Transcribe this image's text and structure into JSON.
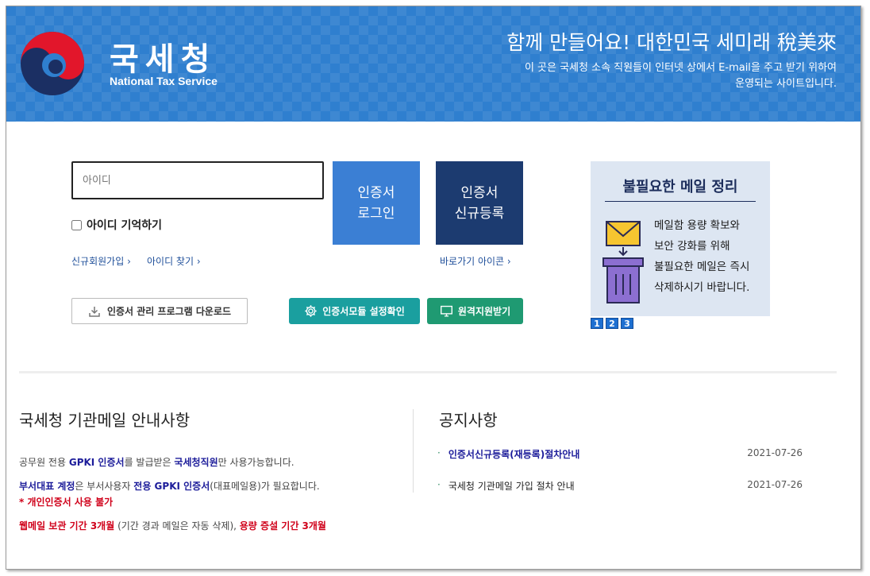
{
  "header": {
    "brand_kr": "국세청",
    "brand_en": "National Tax Service",
    "slogan": "함께 만들어요! 대한민국 세미래 稅美來",
    "desc_line1": "이 곳은 국세청 소속 직원들이 인터넷 상에서 E-mail을 주고 받기 위하여",
    "desc_line2": "운영되는 사이트입니다."
  },
  "login": {
    "id_placeholder": "아이디",
    "remember_label": "아이디 기억하기",
    "signup_link": "신규회원가입",
    "find_id_link": "아이디 찾기",
    "shortcut_link": "바로가기 아이콘",
    "cert_login_line1": "인증서",
    "cert_login_line2": "로그인",
    "cert_register_line1": "인증서",
    "cert_register_line2": "신규등록",
    "download_label": "인증서 관리 프로그램 다운로드",
    "module_label": "인증서모듈 설정확인",
    "remote_label": "원격지원받기"
  },
  "banner": {
    "title": "불필요한 메일 정리",
    "line1": "메일함 용량 확보와",
    "line2": "보안 강화를 위해",
    "line3": "불필요한 메일은 즉시",
    "line4": "삭제하시기 바랍니다.",
    "pages": [
      "1",
      "2",
      "3"
    ]
  },
  "guide": {
    "title": "국세청 기관메일 안내사항",
    "l1_a": "공무원 전용 ",
    "l1_b": "GPKI 인증서",
    "l1_c": "를 발급받은 ",
    "l1_d": "국세청직원",
    "l1_e": "만 사용가능합니다.",
    "l2_a": "부서대표 계정",
    "l2_b": "은 부서사용자 ",
    "l2_c": "전용 GPKI 인증서",
    "l2_d": "(대표메일용)가 필요합니다.",
    "l3": "* 개인인증서 사용 불가",
    "l4_a": "웹메일 보관 기간 3개월",
    "l4_b": " (기간 경과 메일은 자동 삭제), ",
    "l4_c": "용량 증설 기간 3개월"
  },
  "notice": {
    "title": "공지사항",
    "items": [
      {
        "title": "인증서신규등록(재등록)절차안내",
        "date": "2021-07-26"
      },
      {
        "title": "국세청 기관메일 가입 절차 안내",
        "date": "2021-07-26"
      }
    ]
  },
  "colors": {
    "header_bg": "#2f7fcf",
    "cert_login": "#3b7fd4",
    "cert_register": "#1c3b70",
    "module_btn": "#1a9f9f",
    "remote_btn": "#1f9a72",
    "emphasis_blue": "#1c1c9a",
    "emphasis_red": "#d0021b"
  }
}
